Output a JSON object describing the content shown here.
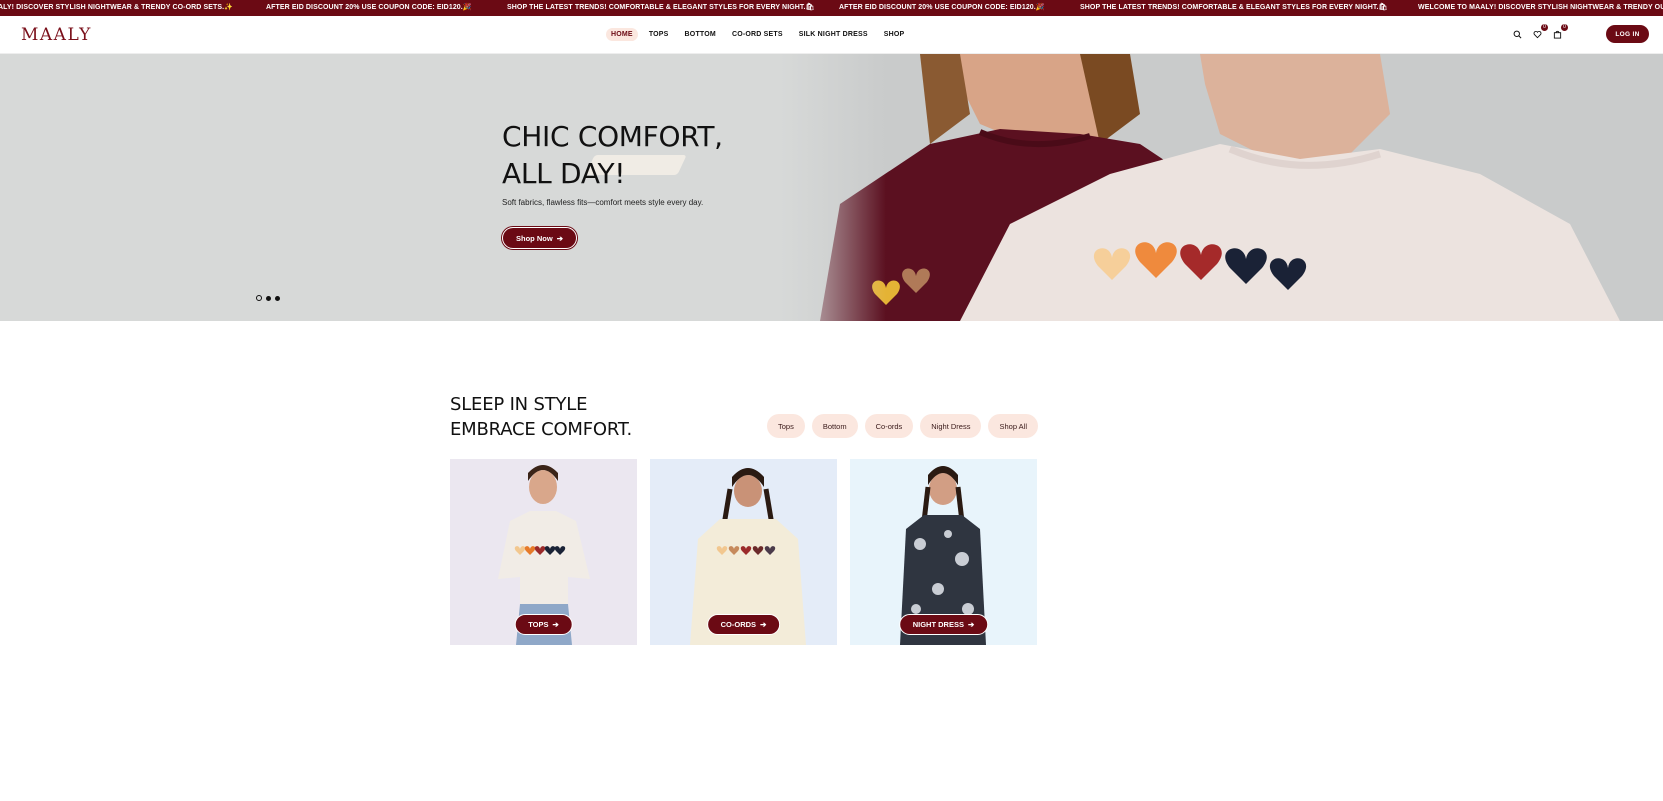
{
  "ticker": {
    "items": [
      "ALY! DISCOVER STYLISH NIGHTWEAR & TRENDY CO-ORD SETS.✨",
      "AFTER EID DISCOUNT 20% USE COUPON CODE: EID120.🎉",
      "SHOP THE LATEST TRENDS! COMFORTABLE & ELEGANT STYLES FOR EVERY NIGHT.🛍",
      "AFTER EID DISCOUNT 20% USE COUPON CODE: EID120.🎉",
      "SHOP THE LATEST TRENDS! COMFORTABLE & ELEGANT STYLES FOR EVERY NIGHT.🛍",
      "WELCOME TO MAALY! DISCOVER STYLISH NIGHTWEAR & TRENDY OUTFITS"
    ]
  },
  "header": {
    "logo": "MAALY",
    "nav": [
      "HOME",
      "TOPS",
      "BOTTOM",
      "CO-ORD SETS",
      "SILK NIGHT DRESS",
      "SHOP"
    ],
    "wishlist_count": "0",
    "cart_count": "0",
    "login_label": "LOG IN",
    "icons": [
      "search-icon",
      "heart-icon",
      "cart-icon"
    ]
  },
  "hero": {
    "title_line1": "CHIC COMFORT,",
    "title_line2": "ALL DAY!",
    "subtitle": "Soft fabrics, flawless fits—comfort meets style every day.",
    "cta": "Shop Now",
    "slides_count": 3,
    "active_slide": 1
  },
  "section": {
    "title_line1": "SLEEP IN STYLE",
    "title_line2": "EMBRACE COMFORT.",
    "filters": [
      "Tops",
      "Bottom",
      "Co-ords",
      "Night Dress",
      "Shop All"
    ],
    "cards": [
      {
        "label": "TOPS",
        "bg": "#ebe7f0"
      },
      {
        "label": "CO-ORDS",
        "bg": "#e4ecf8"
      },
      {
        "label": "NIGHT DRESS",
        "bg": "#e8f4fb"
      }
    ]
  },
  "colors": {
    "brand": "#6b0a14",
    "pill_bg": "#fbe7df",
    "hero_bg": "#d7d9d8"
  }
}
